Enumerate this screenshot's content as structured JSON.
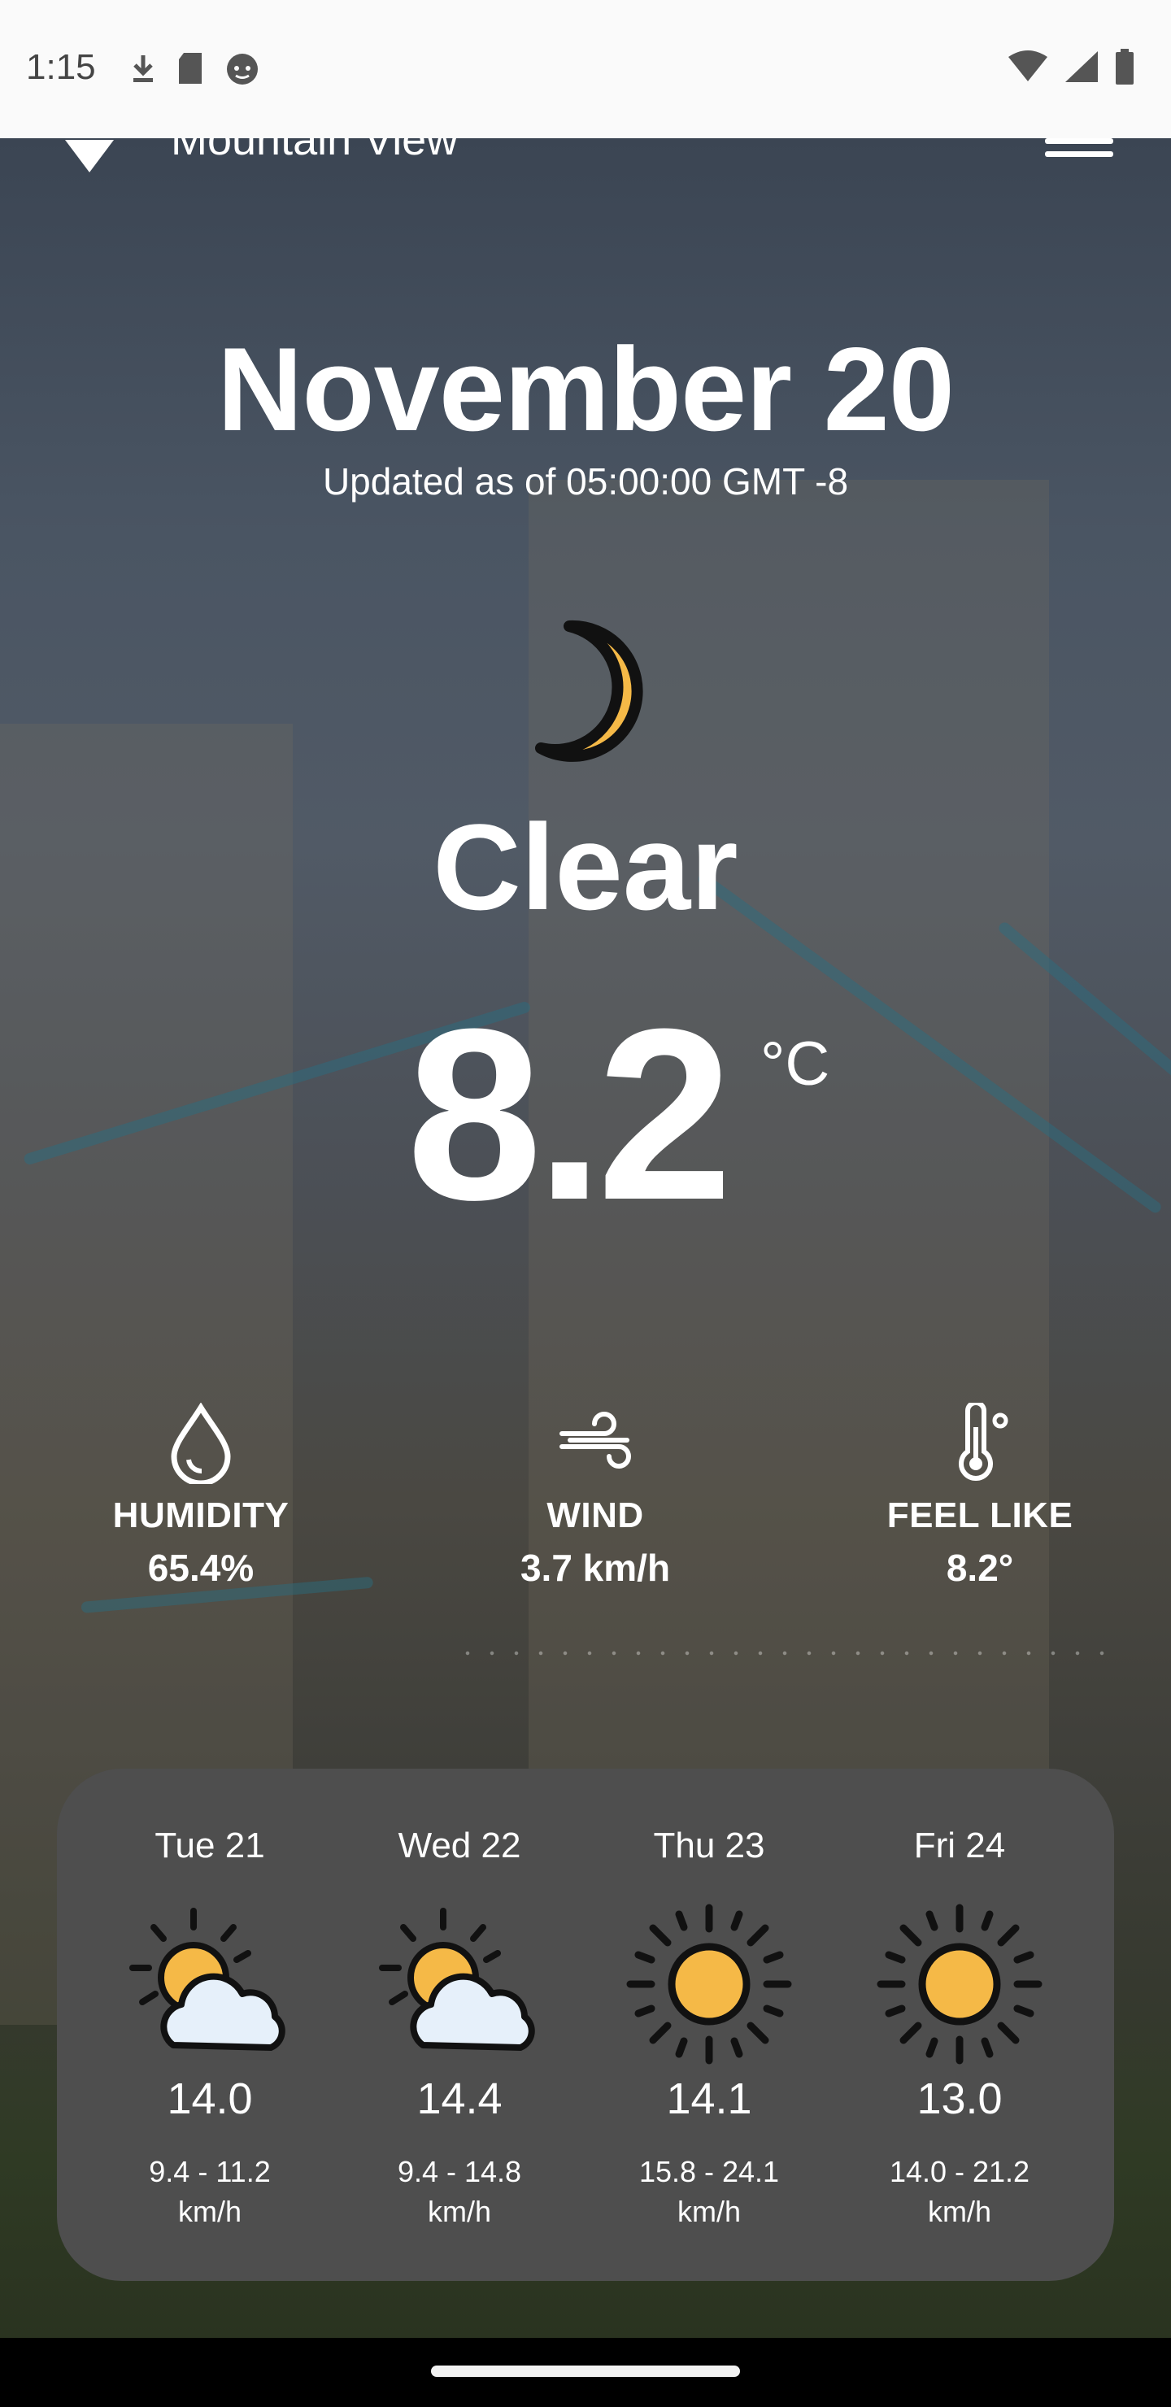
{
  "status_bar": {
    "time": "1:15",
    "left_icons": [
      "download-icon",
      "sd-card-icon",
      "cat-icon"
    ],
    "right_icons": [
      "wifi-icon",
      "cell-signal-icon",
      "battery-icon"
    ]
  },
  "header": {
    "location": "Mountain View",
    "location_icon": "location-pin-icon",
    "menu_icon": "hamburger-menu-icon"
  },
  "current": {
    "date": "November 20",
    "updated": "Updated as of  05:00:00 GMT  -8",
    "condition_icon": "moon-icon",
    "condition": "Clear",
    "temperature": "8.2",
    "unit": "°C"
  },
  "metrics": [
    {
      "icon": "humidity-drop-icon",
      "label": "HUMIDITY",
      "value": "65.4%"
    },
    {
      "icon": "wind-icon",
      "label": "WIND",
      "value": "3.7 km/h"
    },
    {
      "icon": "thermometer-icon",
      "label": "FEEL LIKE",
      "value": "8.2°"
    }
  ],
  "forecast": [
    {
      "day": "Tue 21",
      "icon": "partly-cloudy-icon",
      "temp": "14.0",
      "wind_range": "9.4 - 11.2",
      "wind_unit": "km/h"
    },
    {
      "day": "Wed 22",
      "icon": "partly-cloudy-icon",
      "temp": "14.4",
      "wind_range": "9.4 - 14.8",
      "wind_unit": "km/h"
    },
    {
      "day": "Thu 23",
      "icon": "sun-icon",
      "temp": "14.1",
      "wind_range": "15.8 - 24.1",
      "wind_unit": "km/h"
    },
    {
      "day": "Fri 24",
      "icon": "sun-icon",
      "temp": "13.0",
      "wind_range": "14.0 - 21.2",
      "wind_unit": "km/h"
    }
  ],
  "colors": {
    "accent_yellow": "#f5b947",
    "card_bg": "#4e4e4e",
    "cloud": "#e6f0fa"
  }
}
